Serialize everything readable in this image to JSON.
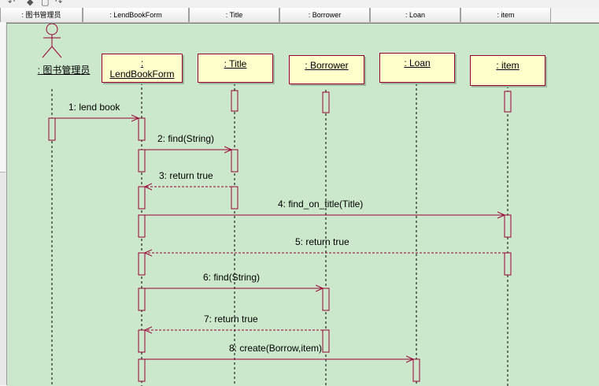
{
  "header": {
    "columns": [
      ": 图书管理员",
      ": LendBookForm",
      ": Title",
      ": Borrower",
      ": Loan",
      ": item"
    ]
  },
  "actor": {
    "label": ": 图书管理员",
    "icon": "stick-figure-actor-icon"
  },
  "objects": [
    {
      "id": "lendbookform",
      "line1": ":",
      "line2": "LendBookForm"
    },
    {
      "id": "title",
      "label": ": Title"
    },
    {
      "id": "borrower",
      "label": ": Borrower"
    },
    {
      "id": "loan",
      "label": ": Loan"
    },
    {
      "id": "item",
      "label": ": item"
    }
  ],
  "messages": [
    {
      "label": "1: lend book",
      "from": "actor",
      "to": "lendbookform",
      "kind": "call"
    },
    {
      "label": "2: find(String)",
      "from": "lendbookform",
      "to": "title",
      "kind": "call"
    },
    {
      "label": "3: return true",
      "from": "title",
      "to": "lendbookform",
      "kind": "return"
    },
    {
      "label": "4: find_on_title(Title)",
      "from": "lendbookform",
      "to": "item",
      "kind": "call"
    },
    {
      "label": "5: return true",
      "from": "item",
      "to": "lendbookform",
      "kind": "return"
    },
    {
      "label": "6: find(String)",
      "from": "lendbookform",
      "to": "borrower",
      "kind": "call"
    },
    {
      "label": "7: return true",
      "from": "borrower",
      "to": "lendbookform",
      "kind": "return"
    },
    {
      "label": "8: create(Borrow,item)",
      "from": "lendbookform",
      "to": "loan",
      "kind": "call"
    }
  ],
  "colors": {
    "canvas": "#cce8cc",
    "object_fill": "#ffffcc",
    "stroke": "#990033",
    "lifeline": "#000000"
  }
}
